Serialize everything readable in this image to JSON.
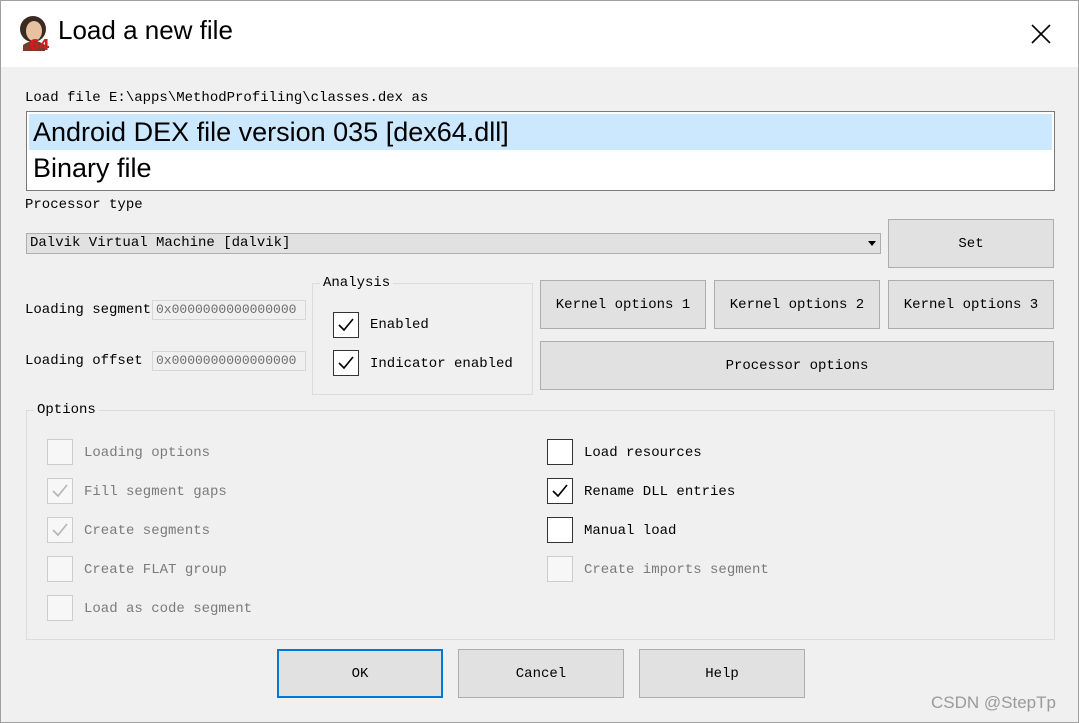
{
  "window": {
    "title": "Load a new file",
    "icon": "ida64-portrait-icon"
  },
  "load_file_label": "Load file E:\\apps\\MethodProfiling\\classes.dex as",
  "file_types": [
    {
      "label": "Android DEX file version 035 [dex64.dll]",
      "selected": true
    },
    {
      "label": "Binary file",
      "selected": false
    }
  ],
  "processor": {
    "label": "Processor type",
    "value": "Dalvik Virtual Machine [dalvik]",
    "set_button": "Set"
  },
  "loading_segment": {
    "label": "Loading segment",
    "value": "0x0000000000000000"
  },
  "loading_offset": {
    "label": "Loading offset",
    "value": "0x0000000000000000"
  },
  "analysis": {
    "title": "Analysis",
    "enabled": {
      "label": "Enabled",
      "checked": true
    },
    "indicator": {
      "label": "Indicator enabled",
      "checked": true
    }
  },
  "kernel_buttons": [
    "Kernel options 1",
    "Kernel options 2",
    "Kernel options 3"
  ],
  "processor_options_button": "Processor options",
  "options": {
    "title": "Options",
    "left": [
      {
        "label": "Loading options",
        "checked": false,
        "disabled": true
      },
      {
        "label": "Fill segment gaps",
        "checked": true,
        "disabled": true
      },
      {
        "label": "Create segments",
        "checked": true,
        "disabled": true
      },
      {
        "label": "Create FLAT group",
        "checked": false,
        "disabled": true
      },
      {
        "label": "Load as code segment",
        "checked": false,
        "disabled": true
      }
    ],
    "right": [
      {
        "label": "Load resources",
        "checked": false,
        "disabled": false
      },
      {
        "label": "Rename DLL entries",
        "checked": true,
        "disabled": false
      },
      {
        "label": "Manual load",
        "checked": false,
        "disabled": false
      },
      {
        "label": "Create imports segment",
        "checked": false,
        "disabled": true
      }
    ]
  },
  "buttons": {
    "ok": "OK",
    "cancel": "Cancel",
    "help": "Help"
  },
  "watermark": "CSDN @StepTp"
}
